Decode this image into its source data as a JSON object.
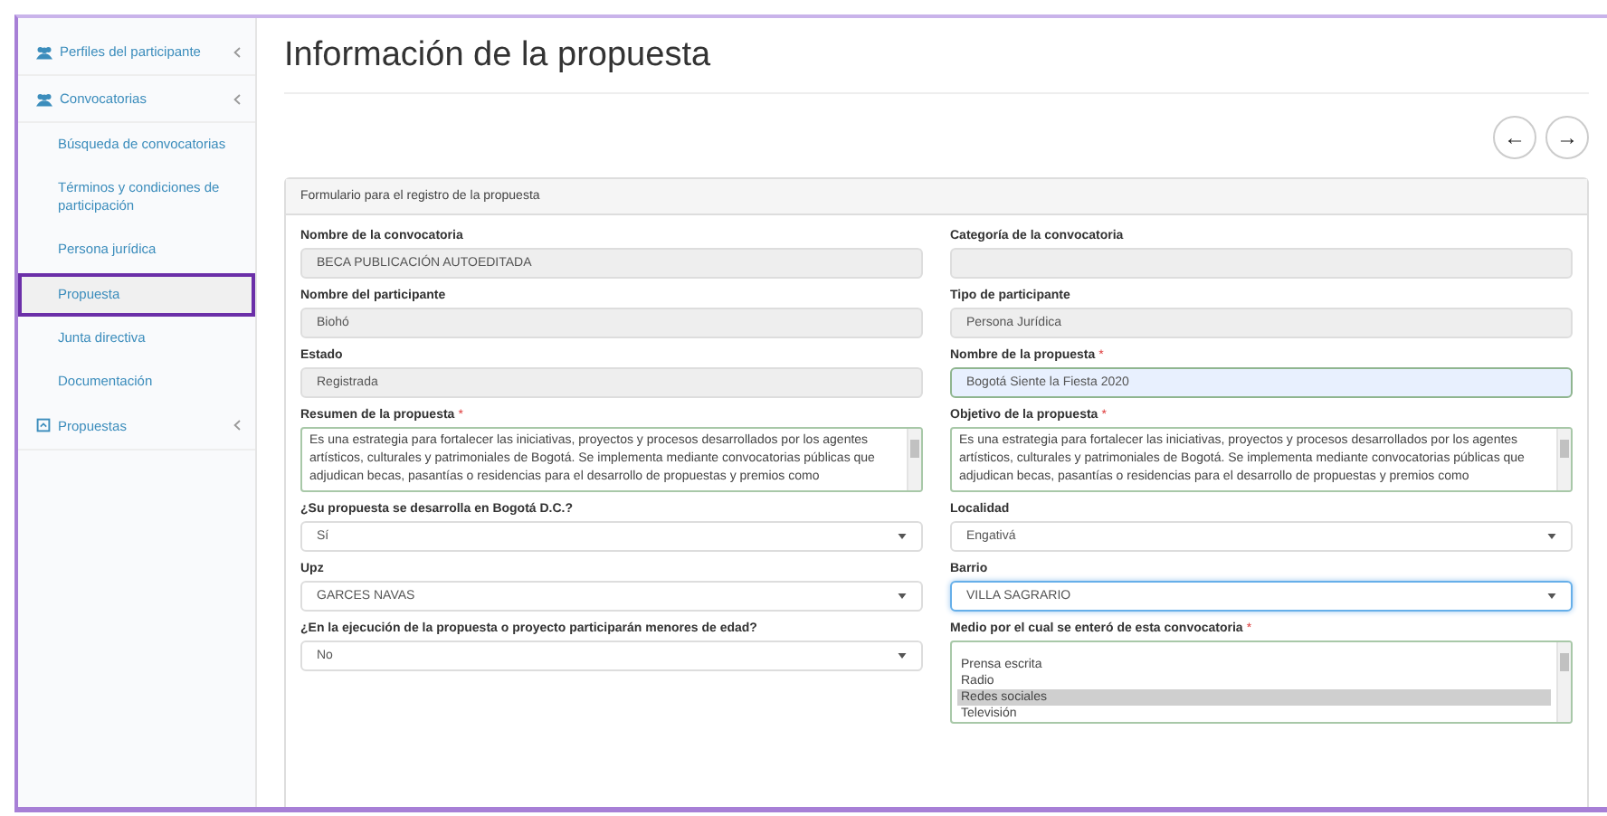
{
  "sidebar": {
    "items": [
      {
        "label": "Perfiles del participante"
      },
      {
        "label": "Convocatorias",
        "children": [
          {
            "label": "Búsqueda de convocatorias",
            "selected": false
          },
          {
            "label": "Términos y condiciones de participación",
            "selected": false
          },
          {
            "label": "Persona jurídica",
            "selected": false
          },
          {
            "label": "Propuesta",
            "selected": true
          },
          {
            "label": "Junta directiva",
            "selected": false
          },
          {
            "label": "Documentación",
            "selected": false
          }
        ]
      },
      {
        "label": "Propuestas"
      }
    ]
  },
  "page": {
    "title": "Información de la propuesta",
    "nav": [
      "←",
      "→"
    ]
  },
  "panel": {
    "heading": "Formulario para el registro de la propuesta",
    "columns": [
      [
        {
          "label": "Nombre de la convocatoria",
          "kind": "text",
          "disabled": true,
          "autofilled": false,
          "focused": false,
          "value": "BECA PUBLICACIÓN AUTOEDITADA"
        },
        {
          "label": "Nombre del participante",
          "kind": "text",
          "disabled": true,
          "autofilled": false,
          "focused": false,
          "value": "Biohó"
        },
        {
          "label": "Estado",
          "kind": "text",
          "disabled": true,
          "autofilled": false,
          "focused": false,
          "value": "Registrada"
        },
        {
          "label": "Resumen de la propuesta",
          "required_mark": "*",
          "kind": "textarea",
          "disabled": false,
          "focused": false,
          "lines": [
            "Es una estrategia para fortalecer las iniciativas, proyectos y procesos desarrollados por los agentes",
            "artísticos, culturales y patrimoniales de Bogotá. Se implementa mediante convocatorias públicas que",
            "adjudican becas, pasantías o residencias para el desarrollo de propuestas y premios como"
          ]
        },
        {
          "label": "¿Su propuesta se desarrolla en Bogotá D.C.?",
          "kind": "select",
          "disabled": false,
          "focused": false,
          "value": "Sí"
        },
        {
          "label": "Upz",
          "kind": "select",
          "disabled": false,
          "focused": false,
          "value": "GARCES NAVAS"
        },
        {
          "label": "¿En la ejecución de la propuesta o proyecto participarán menores de edad?",
          "kind": "select",
          "disabled": false,
          "focused": false,
          "value": "No"
        }
      ],
      [
        {
          "label": "Categoría de la convocatoria",
          "kind": "text",
          "disabled": true,
          "autofilled": false,
          "focused": false
        },
        {
          "label": "Tipo de participante",
          "kind": "text",
          "disabled": true,
          "autofilled": false,
          "focused": false,
          "value": "Persona Jurídica"
        },
        {
          "label": "Nombre de la propuesta",
          "required_mark": "*",
          "kind": "text",
          "disabled": false,
          "autofilled": true,
          "focused": false,
          "value": "Bogotá Siente la Fiesta 2020"
        },
        {
          "label": "Objetivo de la propuesta",
          "required_mark": "*",
          "kind": "textarea",
          "disabled": false,
          "focused": false,
          "lines": [
            "Es una estrategia para fortalecer las iniciativas, proyectos y procesos desarrollados por los agentes",
            "artísticos, culturales y patrimoniales de Bogotá. Se implementa mediante convocatorias públicas que",
            "adjudican becas, pasantías o residencias para el desarrollo de propuestas y premios como"
          ]
        },
        {
          "label": "Localidad",
          "kind": "select",
          "disabled": false,
          "focused": false,
          "value": "Engativá"
        },
        {
          "label": "Barrio",
          "kind": "select",
          "disabled": false,
          "focused": true,
          "value": "VILLA SAGRARIO"
        },
        {
          "label": "Medio por el cual se enteró de esta convocatoria",
          "required_mark": "*",
          "kind": "listbox",
          "disabled": false,
          "focused": false,
          "options": [
            {
              "label": "Prensa escrita",
              "selected": false
            },
            {
              "label": "Radio",
              "selected": false
            },
            {
              "label": "Redes sociales",
              "selected": true
            },
            {
              "label": "Televisión",
              "selected": false
            }
          ]
        }
      ]
    ]
  }
}
